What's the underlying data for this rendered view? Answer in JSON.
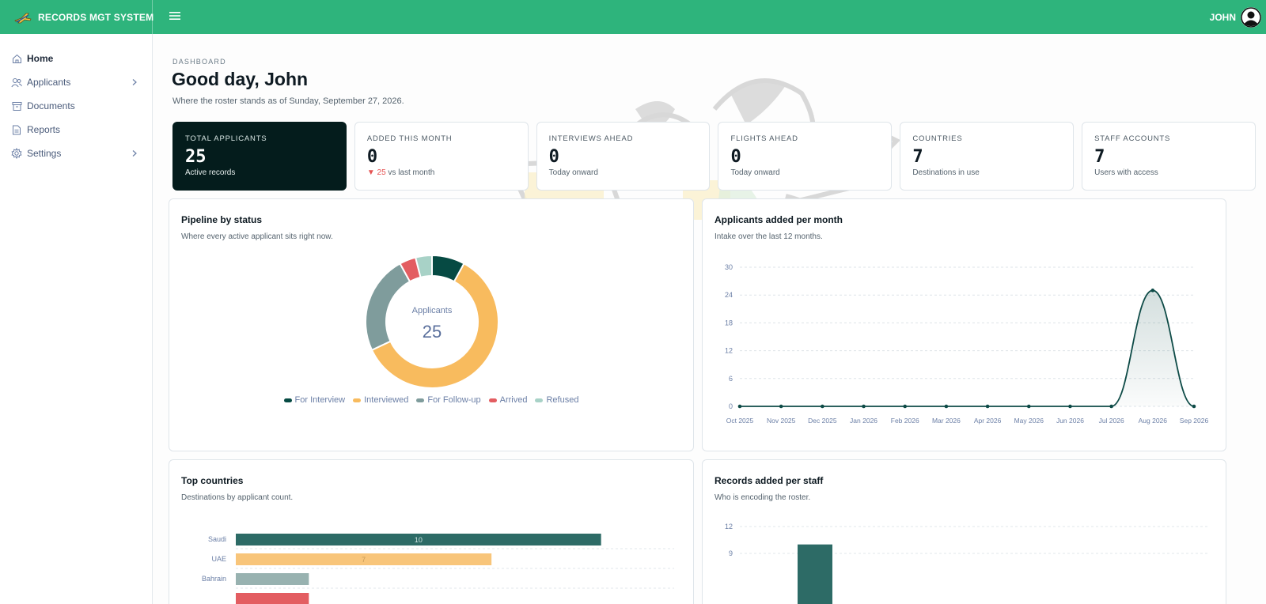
{
  "app": {
    "title": "RECORDS MGT SYSTEM",
    "user": "JOHN"
  },
  "sidebar": {
    "items": [
      {
        "label": "Home",
        "icon": "home-icon",
        "active": true,
        "has_submenu": false
      },
      {
        "label": "Applicants",
        "icon": "users-icon",
        "active": false,
        "has_submenu": true
      },
      {
        "label": "Documents",
        "icon": "archive-icon",
        "active": false,
        "has_submenu": false
      },
      {
        "label": "Reports",
        "icon": "document-icon",
        "active": false,
        "has_submenu": false
      },
      {
        "label": "Settings",
        "icon": "gear-icon",
        "active": false,
        "has_submenu": true
      }
    ]
  },
  "page": {
    "breadcrumb": "DASHBOARD",
    "greeting": "Good day, John",
    "subtitle": "Where the roster stands as of Sunday, September 27, 2026."
  },
  "stats": [
    {
      "label": "TOTAL APPLICANTS",
      "value": "25",
      "foot": "Active records"
    },
    {
      "label": "ADDED THIS MONTH",
      "value": "0",
      "foot_delta": "25",
      "foot": "vs last month"
    },
    {
      "label": "INTERVIEWS AHEAD",
      "value": "0",
      "foot": "Today onward"
    },
    {
      "label": "FLIGHTS AHEAD",
      "value": "0",
      "foot": "Today onward"
    },
    {
      "label": "COUNTRIES",
      "value": "7",
      "foot": "Destinations in use"
    },
    {
      "label": "STAFF ACCOUNTS",
      "value": "7",
      "foot": "Users with access"
    }
  ],
  "cards": {
    "pipeline": {
      "title": "Pipeline by status",
      "subtitle": "Where every active applicant sits right now.",
      "center_label": "Applicants",
      "center_value": "25"
    },
    "monthly": {
      "title": "Applicants added per month",
      "subtitle": "Intake over the last 12 months."
    },
    "countries": {
      "title": "Top countries",
      "subtitle": "Destinations by applicant count."
    },
    "staff": {
      "title": "Records added per staff",
      "subtitle": "Who is encoding the roster."
    }
  },
  "colors": {
    "brand": "#2eb47c",
    "dark_card": "#041c1c",
    "for_interview": "#064a43",
    "interviewed": "#f8bb5e",
    "for_follow_up": "#7f9c9c",
    "arrived": "#e35d61",
    "refused": "#a8d2c7"
  },
  "chart_data": [
    {
      "type": "pie",
      "labels": [
        "For Interview",
        "Interviewed",
        "For Follow-up",
        "Arrived",
        "Refused"
      ],
      "values": [
        2,
        15,
        6,
        1,
        1
      ],
      "colors": [
        "#064a43",
        "#f8bb5e",
        "#7f9c9c",
        "#e35d61",
        "#a8d2c7"
      ],
      "legend": "bottom"
    },
    {
      "type": "area",
      "x": [
        "Oct 2025",
        "Nov 2025",
        "Dec 2025",
        "Jan 2026",
        "Feb 2026",
        "Mar 2026",
        "Apr 2026",
        "May 2026",
        "Jun 2026",
        "Jul 2026",
        "Aug 2026",
        "Sep 2026"
      ],
      "values": [
        0,
        0,
        0,
        0,
        0,
        0,
        0,
        0,
        0,
        0,
        25,
        0
      ],
      "yticks": [
        0,
        6,
        12,
        18,
        24,
        30
      ],
      "ylim": [
        0,
        30
      ],
      "grid": true
    },
    {
      "type": "bar",
      "orientation": "horizontal",
      "categories": [
        "Saudi",
        "UAE",
        "Bahrain"
      ],
      "values": [
        10,
        7,
        2
      ],
      "labels": [
        "10",
        "7",
        ""
      ],
      "colors": [
        "#2d6b66",
        "#f8c57a",
        "#98b2b0"
      ],
      "xlim": [
        0,
        12
      ]
    },
    {
      "type": "bar",
      "categories": [
        ""
      ],
      "values": [
        10
      ],
      "yticks": [
        9,
        12
      ],
      "ylim": [
        0,
        12
      ]
    }
  ]
}
